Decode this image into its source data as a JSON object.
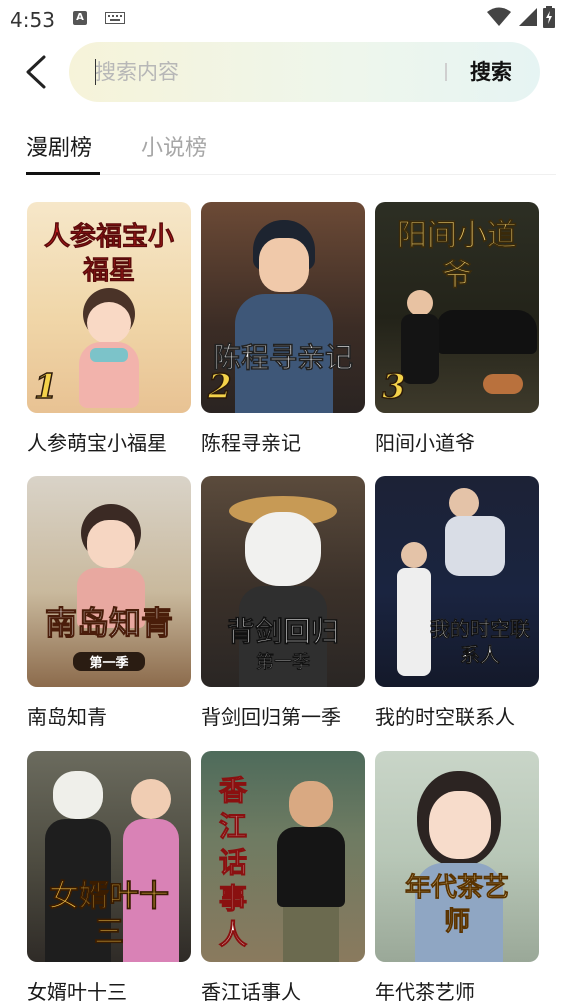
{
  "status": {
    "time": "4:53",
    "a_icon": "A"
  },
  "search": {
    "placeholder": "搜索内容",
    "button": "搜索"
  },
  "tabs": [
    {
      "label": "漫剧榜",
      "active": true
    },
    {
      "label": "小说榜",
      "active": false
    }
  ],
  "items": [
    {
      "title": "人参萌宝小福星",
      "cover_text": "人参福宝小福星",
      "rank": "1"
    },
    {
      "title": "陈程寻亲记",
      "cover_text": "陈程寻亲记",
      "rank": "2"
    },
    {
      "title": "阳间小道爷",
      "cover_text": "阳间小道爷",
      "rank": "3"
    },
    {
      "title": "南岛知青",
      "cover_text": "南岛知青",
      "cover_sub": "第一季"
    },
    {
      "title": "背剑回归第一季",
      "cover_text": "背剑回归",
      "cover_sub": "第一季"
    },
    {
      "title": "我的时空联系人",
      "cover_text": "我的时空联系人"
    },
    {
      "title": "女婿叶十三",
      "cover_text": "女婿叶十三"
    },
    {
      "title": "香江话事人",
      "cover_text": "香江话事人"
    },
    {
      "title": "年代茶艺师",
      "cover_text": "年代茶艺师"
    }
  ]
}
